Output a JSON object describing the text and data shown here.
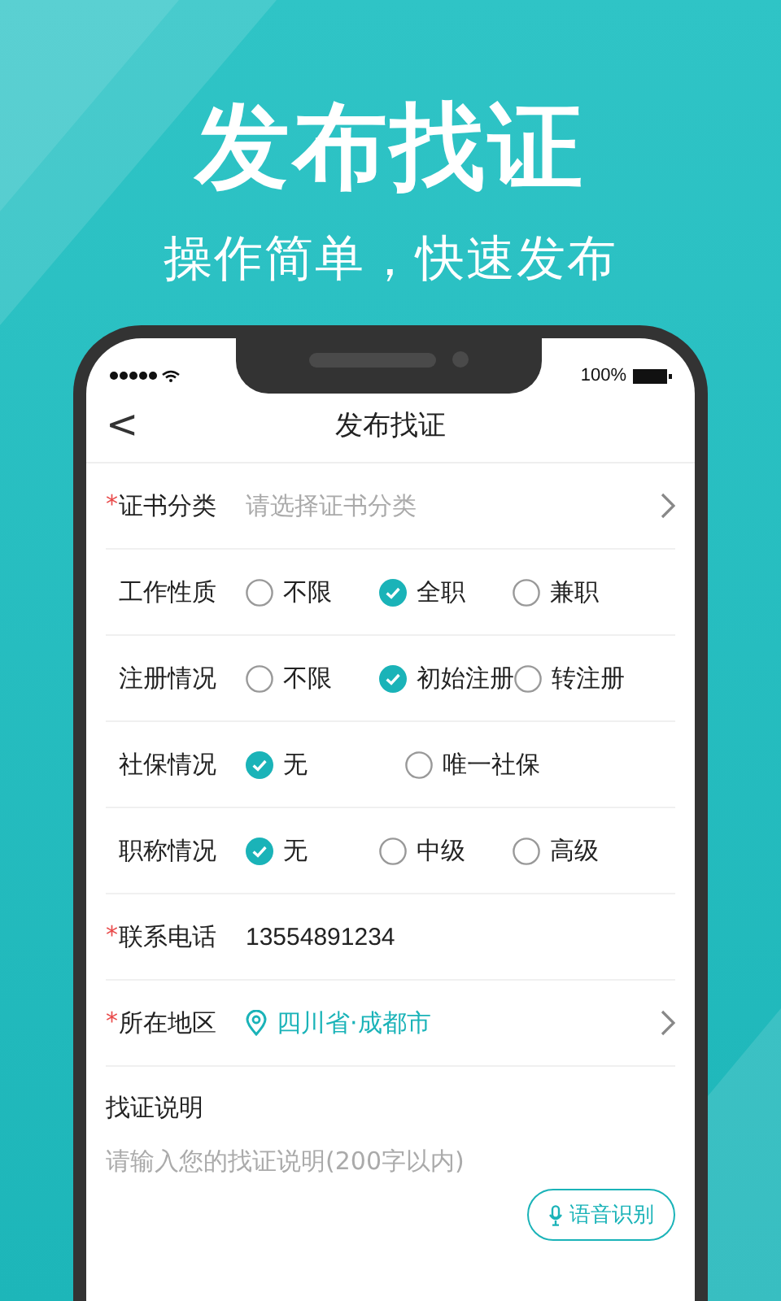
{
  "headline": "发布找证",
  "subheadline": "操作简单，快速发布",
  "status_bar": {
    "battery_text": "100%"
  },
  "nav": {
    "back": "<",
    "title": "发布找证"
  },
  "rows": [
    {
      "kind": "select",
      "mark": "*",
      "label": "证书分类",
      "placeholder": "请选择证书分类"
    },
    {
      "kind": "radio",
      "label": "工作性质",
      "options": [
        {
          "label": "不限",
          "selected": false
        },
        {
          "label": "全职",
          "selected": true
        },
        {
          "label": "兼职",
          "selected": false
        }
      ]
    },
    {
      "kind": "radio",
      "label": "注册情况",
      "options": [
        {
          "label": "不限",
          "selected": false
        },
        {
          "label": "初始注册",
          "selected": true
        },
        {
          "label": "转注册",
          "selected": false
        }
      ]
    },
    {
      "kind": "radio",
      "label": "社保情况",
      "options": [
        {
          "label": "无",
          "selected": true
        },
        {
          "label": "唯一社保",
          "selected": false
        }
      ]
    },
    {
      "kind": "radio",
      "label": "职称情况",
      "options": [
        {
          "label": "无",
          "selected": true
        },
        {
          "label": "中级",
          "selected": false
        },
        {
          "label": "高级",
          "selected": false
        }
      ]
    },
    {
      "kind": "text",
      "mark": "*",
      "label": "联系电话",
      "value": "13554891234"
    },
    {
      "kind": "location",
      "mark": "*",
      "label": "所在地区",
      "value": "四川省·成都市"
    }
  ],
  "description": {
    "label": "找证说明",
    "placeholder": "请输入您的找证说明(200字以内)",
    "voice_button": "语音识别"
  }
}
